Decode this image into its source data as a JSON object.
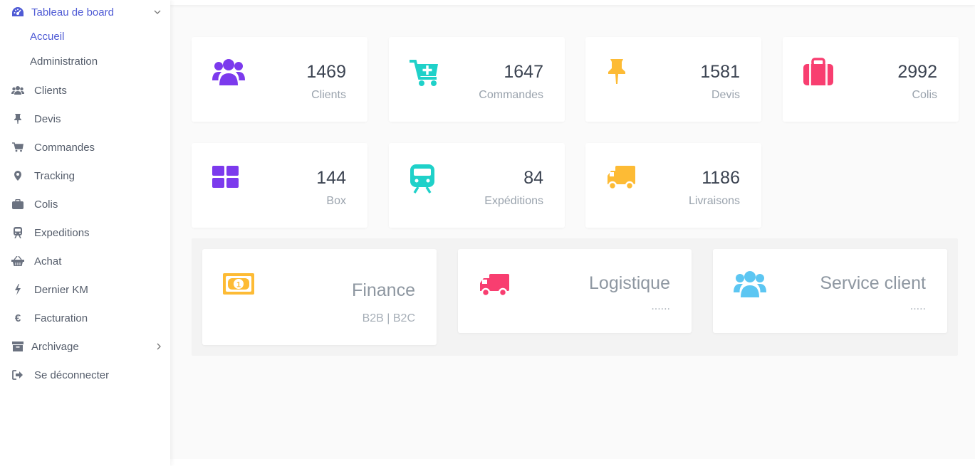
{
  "sidebar": {
    "dashboard": {
      "label": "Tableau de board",
      "icon": "tachometer-icon"
    },
    "submenu": [
      "Accueil",
      "Administration"
    ],
    "items": [
      {
        "label": "Clients",
        "icon": "users-icon"
      },
      {
        "label": "Devis",
        "icon": "thumbtack-icon"
      },
      {
        "label": "Commandes",
        "icon": "cart-icon"
      },
      {
        "label": "Tracking",
        "icon": "map-marker-icon"
      },
      {
        "label": "Colis",
        "icon": "suitcase-icon"
      },
      {
        "label": "Expeditions",
        "icon": "train-icon"
      },
      {
        "label": "Achat",
        "icon": "basket-icon"
      },
      {
        "label": "Dernier KM",
        "icon": "bolt-icon"
      },
      {
        "label": "Facturation",
        "icon": "euro-icon"
      },
      {
        "label": "Archivage",
        "icon": "archive-icon"
      },
      {
        "label": "Se déconnecter",
        "icon": "sign-out-icon"
      }
    ]
  },
  "stats": [
    {
      "value": "1469",
      "label": "Clients",
      "icon": "users-icon",
      "color": "#7c3aed"
    },
    {
      "value": "1647",
      "label": "Commandes",
      "icon": "cart-plus-icon",
      "color": "#1fd1c9"
    },
    {
      "value": "1581",
      "label": "Devis",
      "icon": "thumbtack-icon",
      "color": "#fdbb35"
    },
    {
      "value": "2992",
      "label": "Colis",
      "icon": "suitcase-icon",
      "color": "#f83e70"
    },
    {
      "value": "144",
      "label": "Box",
      "icon": "grid-icon",
      "color": "#7c3aed"
    },
    {
      "value": "84",
      "label": "Expéditions",
      "icon": "train-icon",
      "color": "#1fd1c9"
    },
    {
      "value": "1186",
      "label": "Livraisons",
      "icon": "truck-icon",
      "color": "#fdbb35"
    }
  ],
  "departments": [
    {
      "title": "Finance",
      "subtitle": "B2B | B2C",
      "icon": "money-bill-icon",
      "color": "#fdbb35"
    },
    {
      "title": "Logistique",
      "subtitle": "......",
      "icon": "truck-icon",
      "color": "#f83e70"
    },
    {
      "title": "Service client",
      "subtitle": ".....",
      "icon": "users-icon",
      "color": "#5cc6f2"
    }
  ]
}
